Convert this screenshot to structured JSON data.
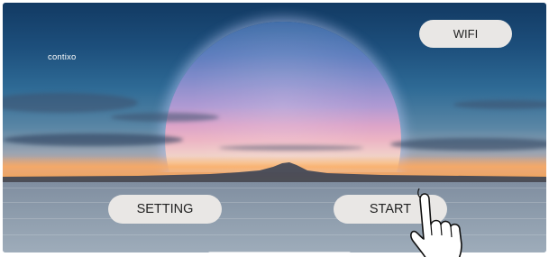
{
  "brand": {
    "label": "contixo"
  },
  "header": {
    "wifi_label": "WIFI"
  },
  "controls": {
    "setting_label": "SETTING",
    "start_label": "START"
  },
  "decorations": {
    "pointer_icon": "hand-tap-icon",
    "home_indicator": "home-indicator-bar"
  },
  "colors": {
    "button_bg": "#e9e7e5",
    "button_text": "#222222",
    "brand_text": "#ffffff"
  }
}
